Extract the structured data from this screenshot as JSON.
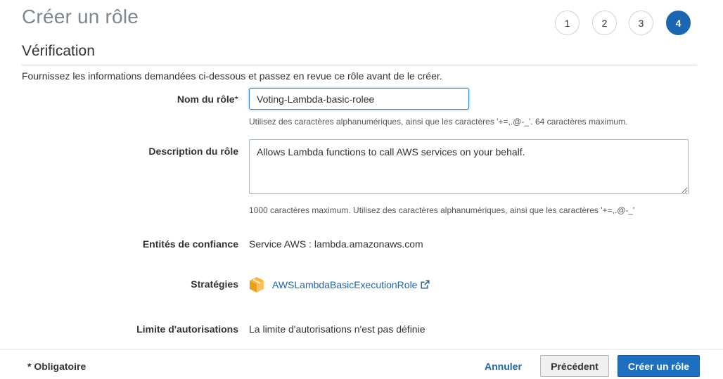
{
  "page": {
    "title": "Créer un rôle",
    "steps": [
      "1",
      "2",
      "3",
      "4"
    ],
    "active_step": 4
  },
  "section": {
    "title": "Vérification",
    "intro": "Fournissez les informations demandées ci-dessous et passez en revue ce rôle avant de le créer."
  },
  "form": {
    "role_name": {
      "label": "Nom du rôle",
      "required_mark": "*",
      "value": "Voting-Lambda-basic-rolee",
      "hint": "Utilisez des caractères alphanumériques, ainsi que les caractères '+=,.@-_'. 64 caractères maximum."
    },
    "description": {
      "label": "Description du rôle",
      "value": "Allows Lambda functions to call AWS services on your behalf.",
      "hint": "1000 caractères maximum. Utilisez des caractères alphanumériques, ainsi que les caractères '+=,.@-_'"
    },
    "trusted_entities": {
      "label": "Entités de confiance",
      "value": "Service AWS : lambda.amazonaws.com"
    },
    "policies": {
      "label": "Stratégies",
      "link": "AWSLambdaBasicExecutionRole",
      "icon": "package-cube-icon"
    },
    "permissions_boundary": {
      "label": "Limite d'autorisations",
      "value": "La limite d'autorisations n'est pas définie"
    }
  },
  "footer": {
    "required_note": "* Obligatoire",
    "cancel_label": "Annuler",
    "previous_label": "Précédent",
    "create_label": "Créer un rôle"
  },
  "colors": {
    "accent": "#1b66b0",
    "primary_button": "#1d6fc1",
    "policy_icon": "#f0a30a"
  }
}
